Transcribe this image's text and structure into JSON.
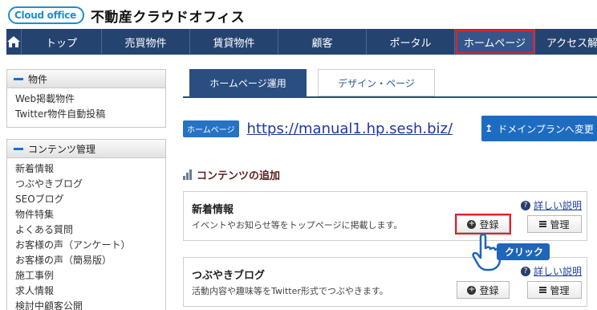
{
  "logo": {
    "badge": "Cloud office",
    "title": "不動産クラウドオフィス"
  },
  "nav": {
    "items": [
      {
        "label": "トップ",
        "width": 100
      },
      {
        "label": "売買物件",
        "width": 110
      },
      {
        "label": "賃貸物件",
        "width": 110
      },
      {
        "label": "顧客",
        "width": 110
      },
      {
        "label": "ポータル",
        "width": 110
      },
      {
        "label": "ホームページ",
        "width": 100
      },
      {
        "label": "アクセス解析",
        "width": 105
      }
    ],
    "active_index": 5
  },
  "sidebar": {
    "sections": [
      {
        "title": "物件",
        "items": [
          "Web掲載物件",
          "Twitter物件自動投稿"
        ]
      },
      {
        "title": "コンテンツ管理",
        "items": [
          "新着情報",
          "つぶやきブログ",
          "SEOブログ",
          "物件特集",
          "よくある質問",
          "お客様の声（アンケート）",
          "お客様の声（簡易版）",
          "施工事例",
          "求人情報",
          "検討中顧客公開"
        ]
      }
    ]
  },
  "main": {
    "tabs": [
      "ホームページ運用",
      "デザイン・ページ"
    ],
    "active_tab": 0,
    "hp_badge": "ホームページ",
    "url": "https://manual1.hp.sesh.biz/",
    "domain_button": "ドメインプランへ変更",
    "section_title": "コンテンツの追加",
    "cards": [
      {
        "title": "新着情報",
        "desc": "イベントやお知らせ等をトップページに掲載します。",
        "help": "詳しい説明",
        "register": "登録",
        "manage": "管理",
        "highlight": true
      },
      {
        "title": "つぶやきブログ",
        "desc": "活動内容や趣味等をTwitter形式でつぶやきます。",
        "help": "詳しい説明",
        "register": "登録",
        "manage": "管理",
        "highlight": false
      }
    ]
  },
  "pointer": {
    "label": "クリック"
  },
  "colors": {
    "nav_bg": "#25436f",
    "accent_blue": "#1e6cc2",
    "highlight_red": "#e0202a"
  }
}
